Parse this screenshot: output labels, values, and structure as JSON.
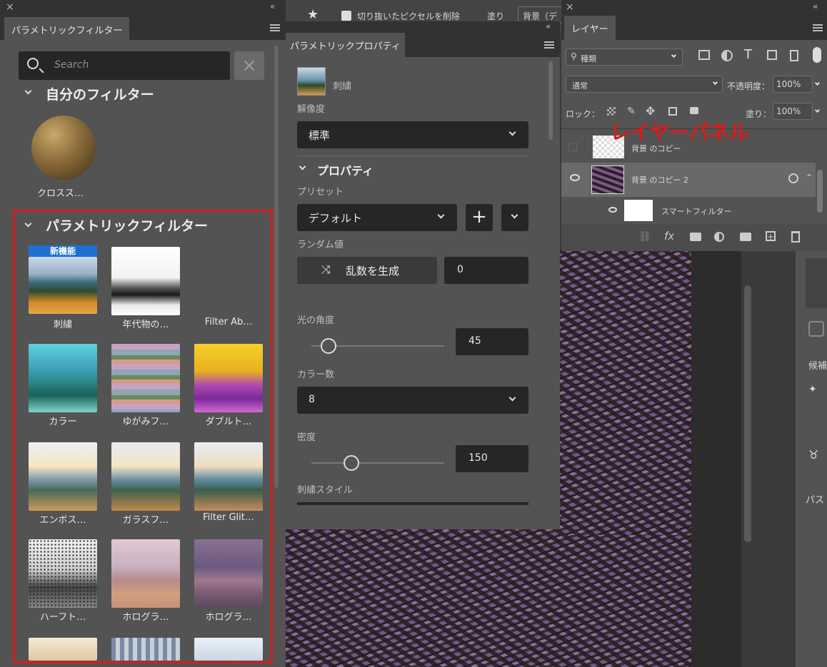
{
  "filters_panel": {
    "tab": "パラメトリックフィルター",
    "search_placeholder": "Search",
    "my_filters_header": "自分のフィルター",
    "my_filter_item": "クロスス…",
    "parametric_header": "パラメトリックフィルター",
    "new_badge": "新機能",
    "items": [
      "刺繍",
      "年代物の…",
      "Filter Ab…",
      "カラー",
      "ゆがみフ…",
      "ダブルト…",
      "エンボス…",
      "ガラスフ…",
      "Filter Glit…",
      "ハーフト…",
      "ホログラ…",
      "ホログラ…"
    ]
  },
  "properties_panel": {
    "tab": "パラメトリックプロパティ",
    "filter_name": "刺繍",
    "resolution_label": "解像度",
    "resolution_value": "標準",
    "properties_header": "プロパティ",
    "preset_label": "プリセット",
    "preset_value": "デフォルト",
    "random_label": "ランダム値",
    "random_button": "乱数を生成",
    "random_value": "0",
    "light_angle_label": "光の角度",
    "light_angle_value": "45",
    "light_angle_fraction": 0.13,
    "color_count_label": "カラー数",
    "color_count_value": "8",
    "density_label": "密度",
    "density_value": "150",
    "density_fraction": 0.3,
    "style_label": "刺繍スタイル"
  },
  "layers_panel": {
    "tab": "レイヤー",
    "kind_filter": "種類",
    "blend_mode": "通常",
    "opacity_label": "不透明度：",
    "opacity_value": "100%",
    "lock_label": "ロック：",
    "fill_label": "塗り：",
    "fill_value": "100%",
    "annotation": "レイヤーパネル",
    "layers": [
      "背景 のコピー",
      "背景 のコピー 2",
      "スマートフィルター"
    ]
  },
  "top_bar": {
    "delete_cropped_label": "切り抜いたピクセルを削除",
    "fill_label": "塗り",
    "mode_label": "背景（デ"
  },
  "right_strip": {
    "tab_candidates": "候補",
    "tab_paths": "パス"
  },
  "colors": {
    "panel": "#535353",
    "field": "#262626",
    "highlight": "#e01818",
    "badge": "#1d6fd6"
  }
}
